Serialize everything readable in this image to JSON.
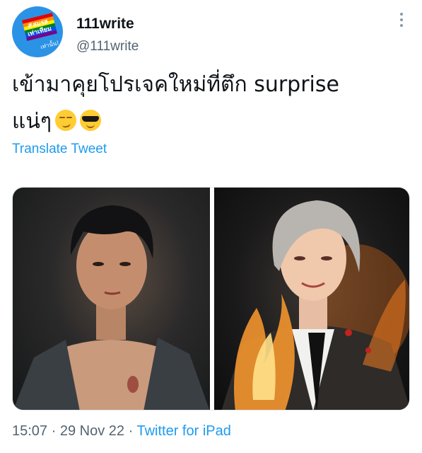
{
  "author": {
    "display_name": "111write",
    "handle": "@111write",
    "avatar_text_1": "#สมรส",
    "avatar_text_2": "เท่าเทียม",
    "avatar_text_3": "เท่านั้น!"
  },
  "tweet": {
    "text_line_1": "เข้ามาคุยโปรเจคใหม่ที่ตึก surprise",
    "text_line_2": "แน่ๆ",
    "emojis": [
      "smirking-face",
      "smiling-face-with-sunglasses"
    ],
    "translate_label": "Translate Tweet"
  },
  "media": {
    "images": [
      {
        "alt_name": "dark-haired-man-shirtless-illustration"
      },
      {
        "alt_name": "silver-haired-man-in-suit-with-fire-illustration"
      }
    ]
  },
  "meta": {
    "time": "15:07",
    "date": "29 Nov 22",
    "separator": "·",
    "source": "Twitter for iPad"
  },
  "colors": {
    "accent": "#1d9bf0",
    "secondary_text": "#536471",
    "primary_text": "#0f1419"
  }
}
